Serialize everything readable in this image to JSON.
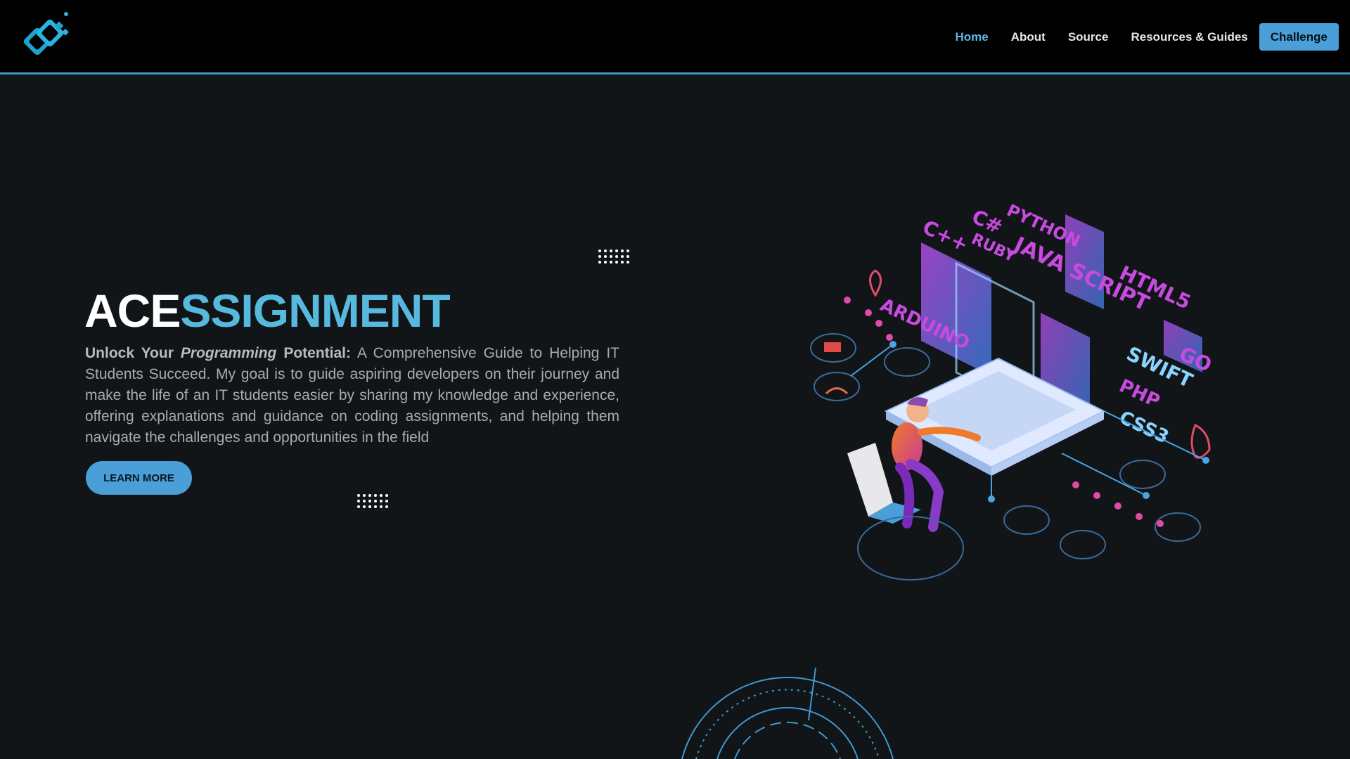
{
  "header": {
    "logo_icon": "diamond-link-logo-icon",
    "nav": [
      {
        "label": "Home",
        "active": true
      },
      {
        "label": "About",
        "active": false
      },
      {
        "label": "Source",
        "active": false
      },
      {
        "label": "Resources & Guides",
        "active": false
      }
    ],
    "cta_label": "Challenge"
  },
  "hero": {
    "title_part1": "ACE",
    "title_part2": "SSIGNMENT",
    "desc_bold1": "Unlock Your",
    "desc_italic": "Programming",
    "desc_bold2": "Potential:",
    "desc_text": "A Comprehensive Guide to Helping IT Students Succeed. My goal is to guide aspiring developers on their journey and make the life of an IT students easier by sharing my knowledge and experience, offering explanations and guidance on coding assignments, and helping them navigate the challenges and opportunities in the field",
    "button_label": "LEARN MORE"
  },
  "illustration": {
    "labels": [
      "C#",
      "PYTHON",
      "C++",
      "RUBY",
      "JAVA SCRIPT",
      "HTML5",
      "ARDUINO",
      "SWIFT",
      "GO",
      "PHP",
      "CSS3"
    ]
  },
  "colors": {
    "accent": "#56b9dd",
    "button": "#4a9fd8",
    "background": "#111517",
    "header": "#000000",
    "magenta": "#c94ae0"
  }
}
